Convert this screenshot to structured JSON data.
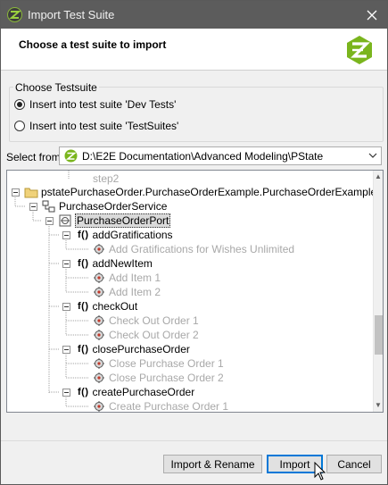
{
  "window": {
    "title": "Import Test Suite"
  },
  "header": {
    "heading": "Choose a test suite to import"
  },
  "testsuite_group": {
    "label": "Choose Testsuite",
    "options": [
      {
        "label": "Insert into test suite 'Dev Tests'",
        "checked": true
      },
      {
        "label": "Insert into test suite 'TestSuites'",
        "checked": false
      }
    ]
  },
  "select_from": {
    "label": "Select from",
    "value": "D:\\E2E Documentation\\Advanced Modeling\\PState"
  },
  "tree": {
    "partial_top": "step2",
    "root": "pstatePurchaseOrder.PurchaseOrderExample.PurchaseOrderExample",
    "service": "PurchaseOrderService",
    "port": "PurchaseOrderPort",
    "function_prefix": "f()",
    "operations": [
      {
        "name": "addGratifications",
        "tests": [
          "Add Gratifications for Wishes Unlimited"
        ]
      },
      {
        "name": "addNewItem",
        "tests": [
          "Add Item 1",
          "Add Item 2"
        ]
      },
      {
        "name": "checkOut",
        "tests": [
          "Check Out Order 1",
          "Check Out Order 2"
        ]
      },
      {
        "name": "closePurchaseOrder",
        "tests": [
          "Close Purchase Order 1",
          "Close Purchase Order 2"
        ]
      },
      {
        "name": "createPurchaseOrder",
        "tests": [
          "Create Purchase Order 1"
        ]
      }
    ]
  },
  "buttons": {
    "import_rename": "Import & Rename",
    "import": "Import",
    "cancel": "Cancel"
  },
  "colors": {
    "titlebar": "#5c5c5c",
    "accent": "#0078d7",
    "logo_green": "#7ab51d"
  }
}
